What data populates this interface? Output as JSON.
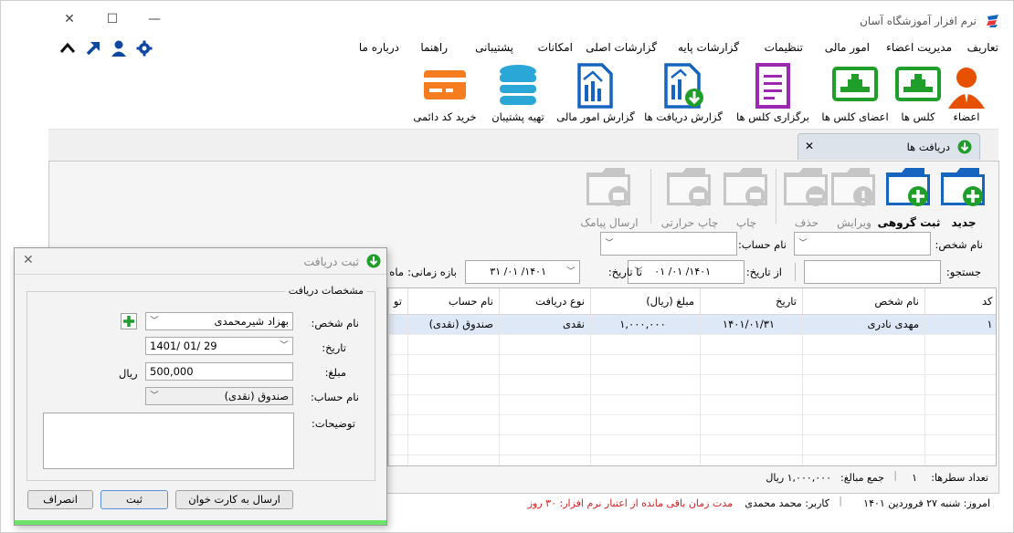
{
  "window": {
    "title": "نرم افزار آموزشگاه آسان"
  },
  "menu": [
    "تعاریف",
    "مدیریت اعضاء",
    "امور مالی",
    "تنظیمات",
    "گزارشات پایه",
    "گزارشات اصلی",
    "امکانات",
    "پشتیبانی",
    "راهنما",
    "درباره ما"
  ],
  "ribbon": [
    "اعضاء",
    "کلس ها",
    "اعضای کلس ها",
    "برگزاری کلس ها",
    "گزارش دریافت ها",
    "گزارش امور مالی",
    "تهیه پشتیبان",
    "خرید کد دائمی"
  ],
  "tab": {
    "label": "دریافت ها"
  },
  "actions": [
    "جدید",
    "ثبت گروهی",
    "ویرایش",
    "حذف",
    "چاپ",
    "چاپ حرارتی",
    "ارسال پیامک"
  ],
  "filters": {
    "person_label": "نام شخص:",
    "account_label": "نام حساب:",
    "search_label": "جستجو:",
    "from_date_label": "از تاریخ:",
    "from_date": "۱۴۰۱/ ۰۱/ ۰۱",
    "to_date_label": "تا تاریخ:",
    "to_date": "۱۴۰۱/ ۰۱/ ۳۱",
    "period_label": "بازه زمانی:",
    "period_value": "ماه"
  },
  "grid": {
    "headers": [
      "کد",
      "نام شخص",
      "تاریخ",
      "مبلغ (ریال)",
      "نوع دریافت",
      "نام حساب",
      "تو"
    ],
    "rows": [
      [
        "۱",
        "مهدی نادری",
        "۱۴۰۱/۰۱/۳۱",
        "۱,۰۰۰,۰۰۰",
        "نقدی",
        "صندوق (نقدی)",
        ""
      ]
    ]
  },
  "summary": {
    "rows_label": "تعداد سطرها:",
    "rows_count": "۱",
    "total_label": "جمع مبالغ:",
    "total_value": "۱,۰۰۰,۰۰۰ ریال"
  },
  "status": {
    "today": "امروز: شنبه ۲۷ فروردین ۱۴۰۱",
    "user": "کاربر: محمد محمدی",
    "license": "مدت زمان باقی مانده از اعتبار نرم افزار: ۳۰ روز"
  },
  "dialog": {
    "title": "ثبت دریافت",
    "group_title": "مشخصات دریافت",
    "person_label": "نام شخص:",
    "person_value": "بهزاد شیرمحمدی",
    "date_label": "تاریخ:",
    "date_value": "1401/ 01/ 29",
    "amount_label": "مبلغ:",
    "amount_value": "500,000",
    "amount_unit": "ریال",
    "account_label": "نام حساب:",
    "account_value": "صندوق (نقدی)",
    "notes_label": "توضیحات:",
    "btn_card": "ارسال به کارت خوان",
    "btn_save": "ثبت",
    "btn_cancel": "انصراف"
  },
  "colors": {
    "accent_green": "#1f9e2a",
    "status_red": "#d32020",
    "icon_blue": "#1565c0",
    "purple": "#9c27b0",
    "orange": "#f57c1f",
    "teal": "#2aa7d6"
  }
}
